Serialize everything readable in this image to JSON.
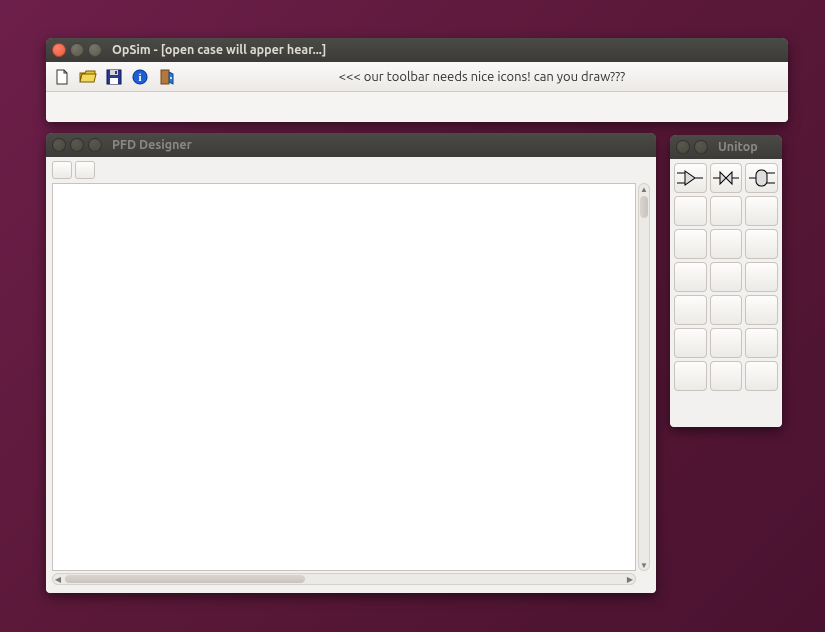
{
  "mainWindow": {
    "title": "OpSim - [open case will apper hear...]",
    "toolbarMessage": "<<< our toolbar needs nice icons! can you draw???",
    "icons": [
      "new-file-icon",
      "open-file-icon",
      "save-icon",
      "info-icon",
      "exit-icon"
    ]
  },
  "pfdWindow": {
    "title": "PFD Designer"
  },
  "unitopWindow": {
    "title": "Unitop",
    "items": [
      "mixer",
      "valve",
      "separator",
      "",
      "",
      "",
      "",
      "",
      "",
      "",
      "",
      "",
      "",
      "",
      "",
      "",
      "",
      "",
      "",
      "",
      ""
    ]
  }
}
